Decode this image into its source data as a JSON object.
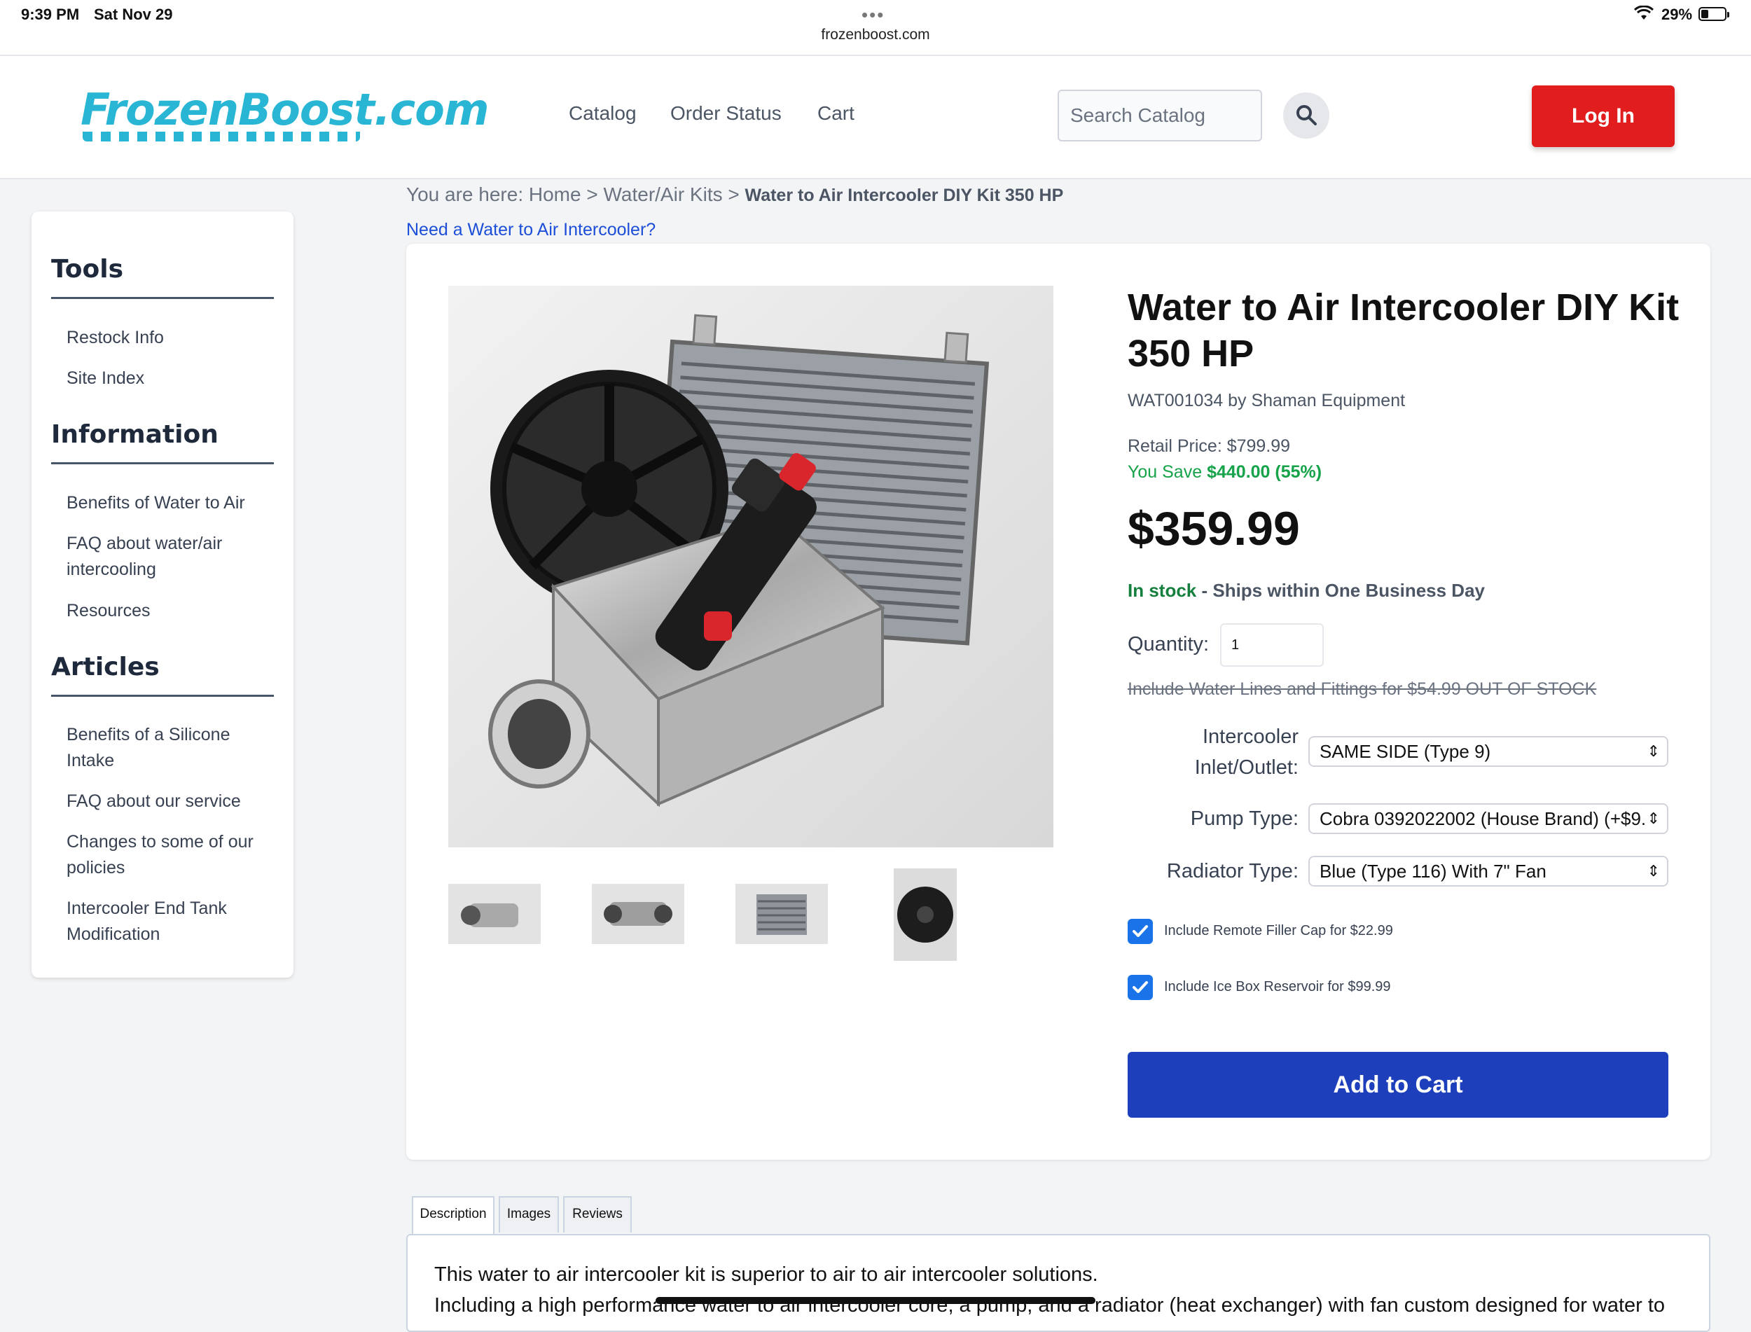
{
  "status_bar": {
    "time": "9:39 PM",
    "date": "Sat Nov 29",
    "url": "frozenboost.com",
    "battery": "29%"
  },
  "header": {
    "logo": "FrozenBoost.com",
    "nav": [
      "Catalog",
      "Order Status",
      "Cart"
    ],
    "search_placeholder": "Search Catalog",
    "login_label": "Log In"
  },
  "sidebar": {
    "sections": [
      {
        "title": "Tools",
        "links": [
          "Restock Info",
          "Site Index"
        ]
      },
      {
        "title": "Information",
        "links": [
          "Benefits of Water to Air",
          "FAQ about water/air intercooling",
          "Resources"
        ]
      },
      {
        "title": "Articles",
        "links": [
          "Benefits of a Silicone Intake",
          "FAQ about our service",
          "Changes to some of our policies",
          "Intercooler End Tank Modification"
        ]
      }
    ]
  },
  "breadcrumb": {
    "prefix": "You are here:",
    "items": [
      "Home",
      "Water/Air Kits"
    ],
    "current": "Water to Air Intercooler DIY Kit 350 HP",
    "sep": ">"
  },
  "need_link": "Need a Water to Air Intercooler?",
  "product": {
    "title": "Water to Air Intercooler DIY Kit 350 HP",
    "sku_line": "WAT001034 by Shaman Equipment",
    "retail": "Retail Price: $799.99",
    "save_prefix": "You Save",
    "save_amount": "$440.00 (55%)",
    "price": "$359.99",
    "stock_status": "In stock",
    "stock_detail": " - Ships within One Business Day",
    "quantity_label": "Quantity:",
    "quantity_value": "1",
    "out_of_stock_option": "Include Water Lines and Fittings for $54.99 OUT OF STOCK",
    "options": [
      {
        "label": "Intercooler Inlet/Outlet:",
        "value": "SAME SIDE (Type 9)"
      },
      {
        "label": "Pump Type:",
        "value": "Cobra 0392022002 (House Brand) (+$9."
      },
      {
        "label": "Radiator Type:",
        "value": "Blue (Type 116) With 7\" Fan"
      }
    ],
    "checkboxes": [
      {
        "label": "Include Remote Filler Cap for $22.99",
        "checked": true
      },
      {
        "label": "Include Ice Box Reservoir for $99.99",
        "checked": true
      }
    ],
    "add_to_cart": "Add to Cart"
  },
  "tabs": [
    "Description",
    "Images",
    "Reviews"
  ],
  "description": {
    "p1": "This water to air intercooler kit is superior to air to air intercooler solutions.",
    "p2": "Including a high performance water to air intercooler core, a pump, and a radiator (heat exchanger) with fan custom designed for water to"
  },
  "colors": {
    "login": "#e11d1d",
    "add_to_cart": "#1e3fbb",
    "in_stock": "#15803d",
    "logo": "#29b6d4"
  }
}
